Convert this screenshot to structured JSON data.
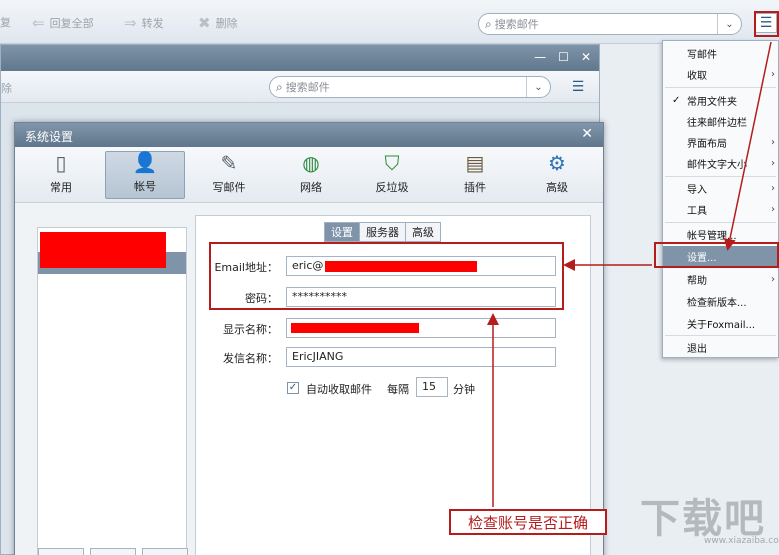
{
  "bg_toolbar": {
    "reply_partial": "复",
    "reply_all": "回复全部",
    "forward": "转发",
    "delete": "删除",
    "search_placeholder": "搜索邮件"
  },
  "mid_window": {
    "delete_partial": "除",
    "search_placeholder": "搜索邮件"
  },
  "dialog": {
    "title": "系统设置",
    "tabs": [
      {
        "label": "常用",
        "icon": "phone-icon"
      },
      {
        "label": "帐号",
        "icon": "user-icon"
      },
      {
        "label": "写邮件",
        "icon": "compose-icon"
      },
      {
        "label": "网络",
        "icon": "globe-icon"
      },
      {
        "label": "反垃圾",
        "icon": "shield-icon"
      },
      {
        "label": "插件",
        "icon": "box-icon"
      },
      {
        "label": "高级",
        "icon": "gear-icon"
      }
    ],
    "subtabs": [
      "设置",
      "服务器",
      "高级"
    ],
    "form": {
      "email_label": "Email地址：",
      "email_value": "eric@",
      "password_label": "密码：",
      "password_value": "**********",
      "display_name_label": "显示名称：",
      "sender_name_label": "发信名称：",
      "sender_name_value": "EricJIANG",
      "auto_receive_label": "自动收取邮件",
      "auto_receive_checked": true,
      "every_label": "每隔",
      "interval_value": "15",
      "minutes_label": "分钟"
    }
  },
  "menu": {
    "items": [
      {
        "label": "写邮件",
        "arrow": false,
        "check": false
      },
      {
        "label": "收取",
        "arrow": true,
        "check": false
      },
      {
        "label": "常用文件夹",
        "arrow": false,
        "check": true
      },
      {
        "label": "往来邮件边栏",
        "arrow": false,
        "check": false
      },
      {
        "label": "界面布局",
        "arrow": true,
        "check": false
      },
      {
        "label": "邮件文字大小",
        "arrow": true,
        "check": false
      },
      {
        "label": "导入",
        "arrow": true,
        "check": false
      },
      {
        "label": "工具",
        "arrow": true,
        "check": false
      },
      {
        "label": "帐号管理...",
        "arrow": false,
        "check": false
      },
      {
        "label": "设置...",
        "arrow": false,
        "check": false,
        "highlighted": true
      },
      {
        "label": "帮助",
        "arrow": true,
        "check": false
      },
      {
        "label": "检查新版本...",
        "arrow": false,
        "check": false
      },
      {
        "label": "关于Foxmail...",
        "arrow": false,
        "check": false
      },
      {
        "label": "退出",
        "arrow": false,
        "check": false
      }
    ]
  },
  "annotation": {
    "note": "检查账号是否正确",
    "color": "#b51c1c"
  },
  "watermark": {
    "text": "下载吧",
    "url": "www.xiazaiba.com"
  }
}
